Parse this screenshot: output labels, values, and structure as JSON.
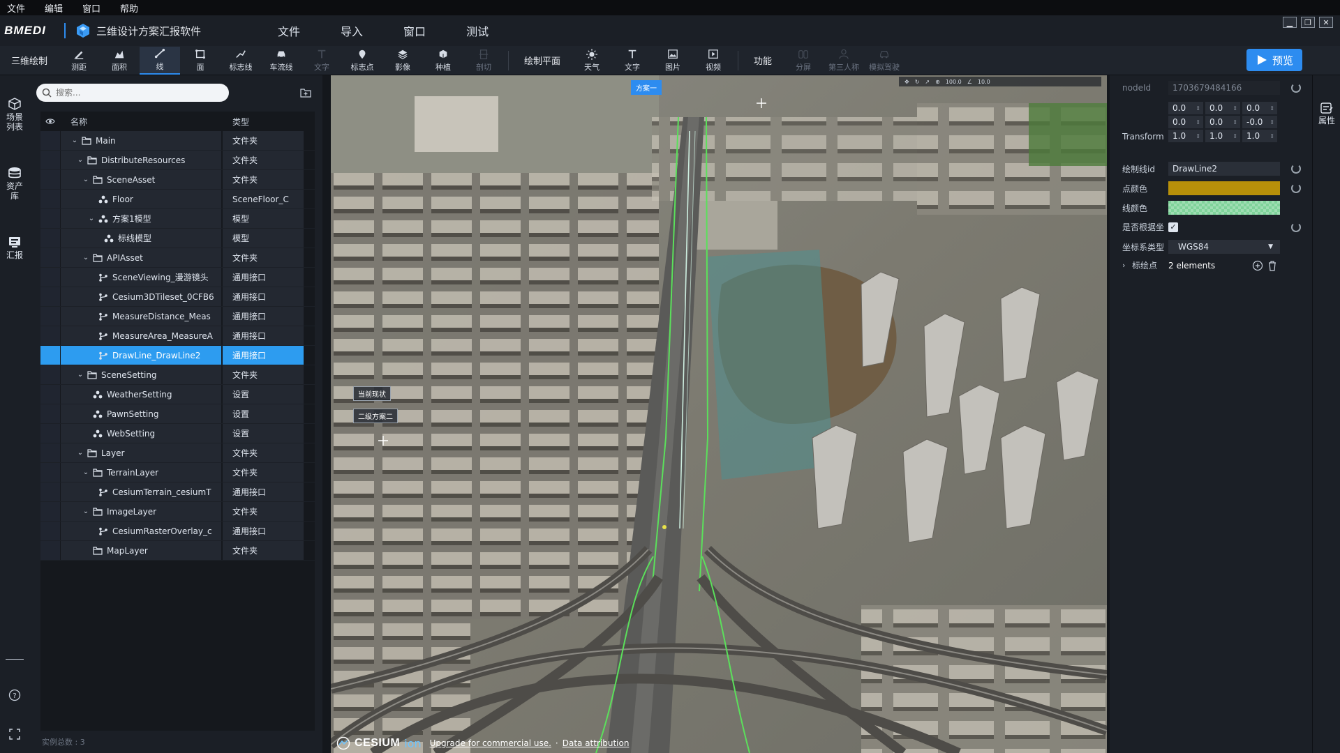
{
  "menubar": [
    "文件",
    "编辑",
    "窗口",
    "帮助"
  ],
  "titlebar": {
    "logo": "BMEDI",
    "app_title": "三维设计方案汇报软件",
    "menu": [
      "文件",
      "导入",
      "窗口",
      "测试"
    ]
  },
  "toolbar": {
    "section_draw": "三维绘制",
    "draw_tools": [
      {
        "label": "测距",
        "icon": "pen-icon",
        "active": false,
        "disabled": false
      },
      {
        "label": "面积",
        "icon": "area-icon",
        "active": false,
        "disabled": false
      },
      {
        "label": "线",
        "icon": "line-icon",
        "active": true,
        "disabled": false
      },
      {
        "label": "面",
        "icon": "polygon-icon",
        "active": false,
        "disabled": false
      },
      {
        "label": "标志线",
        "icon": "polyline-icon",
        "active": false,
        "disabled": false
      },
      {
        "label": "车流线",
        "icon": "car-icon",
        "active": false,
        "disabled": false
      },
      {
        "label": "文字",
        "icon": "text-icon",
        "active": false,
        "disabled": true
      },
      {
        "label": "标志点",
        "icon": "pin-icon",
        "active": false,
        "disabled": false
      },
      {
        "label": "影像",
        "icon": "image-layer-icon",
        "active": false,
        "disabled": false
      },
      {
        "label": "种植",
        "icon": "plant-icon",
        "active": false,
        "disabled": false
      },
      {
        "label": "剖切",
        "icon": "section-icon",
        "active": false,
        "disabled": true
      }
    ],
    "section_plane": "绘制平面",
    "plane_tools": [
      {
        "label": "天气",
        "icon": "sun-icon",
        "disabled": false
      },
      {
        "label": "文字",
        "icon": "text-icon",
        "disabled": false
      },
      {
        "label": "图片",
        "icon": "picture-icon",
        "disabled": false
      },
      {
        "label": "视频",
        "icon": "video-icon",
        "disabled": false
      }
    ],
    "section_func": "功能",
    "func_tools": [
      {
        "label": "分屏",
        "icon": "split-icon",
        "disabled": true
      },
      {
        "label": "第三人称",
        "icon": "person-icon",
        "disabled": true
      },
      {
        "label": "模拟驾驶",
        "icon": "drive-icon",
        "disabled": true
      }
    ],
    "preview_label": "预览"
  },
  "leftnav": [
    {
      "label": "场景列表",
      "icon": "cube-icon"
    },
    {
      "label": "资产库",
      "icon": "database-icon"
    },
    {
      "label": "汇报",
      "icon": "report-icon"
    }
  ],
  "scene": {
    "search_placeholder": "搜索...",
    "col_name": "名称",
    "col_type": "类型",
    "rows": [
      {
        "depth": 0,
        "caret": "v",
        "icon": "folder",
        "name": "Main",
        "type": "文件夹",
        "selected": false
      },
      {
        "depth": 1,
        "caret": "v",
        "icon": "folder",
        "name": "DistributeResources",
        "type": "文件夹",
        "selected": false
      },
      {
        "depth": 2,
        "caret": "v",
        "icon": "folder",
        "name": "SceneAsset",
        "type": "文件夹",
        "selected": false
      },
      {
        "depth": 3,
        "caret": "",
        "icon": "model",
        "name": "Floor",
        "type": "SceneFloor_C",
        "selected": false
      },
      {
        "depth": 3,
        "caret": "v",
        "icon": "model",
        "name": "方案1模型",
        "type": "模型",
        "selected": false
      },
      {
        "depth": 4,
        "caret": "",
        "icon": "model",
        "name": "标线模型",
        "type": "模型",
        "selected": false
      },
      {
        "depth": 2,
        "caret": "v",
        "icon": "folder",
        "name": "APIAsset",
        "type": "文件夹",
        "selected": false
      },
      {
        "depth": 3,
        "caret": "",
        "icon": "api",
        "name": "SceneViewing_漫游镜头",
        "type": "通用接口",
        "selected": false
      },
      {
        "depth": 3,
        "caret": "",
        "icon": "api",
        "name": "Cesium3DTileset_0CFB6",
        "type": "通用接口",
        "selected": false
      },
      {
        "depth": 3,
        "caret": "",
        "icon": "api",
        "name": "MeasureDistance_Meas",
        "type": "通用接口",
        "selected": false
      },
      {
        "depth": 3,
        "caret": "",
        "icon": "api",
        "name": "MeasureArea_MeasureA",
        "type": "通用接口",
        "selected": false
      },
      {
        "depth": 3,
        "caret": "",
        "icon": "api",
        "name": "DrawLine_DrawLine2",
        "type": "通用接口",
        "selected": true
      },
      {
        "depth": 1,
        "caret": "v",
        "icon": "folder",
        "name": "SceneSetting",
        "type": "文件夹",
        "selected": false
      },
      {
        "depth": 2,
        "caret": "",
        "icon": "model",
        "name": "WeatherSetting",
        "type": "设置",
        "selected": false
      },
      {
        "depth": 2,
        "caret": "",
        "icon": "model",
        "name": "PawnSetting",
        "type": "设置",
        "selected": false
      },
      {
        "depth": 2,
        "caret": "",
        "icon": "model",
        "name": "WebSetting",
        "type": "设置",
        "selected": false
      },
      {
        "depth": 1,
        "caret": "v",
        "icon": "folder",
        "name": "Layer",
        "type": "文件夹",
        "selected": false
      },
      {
        "depth": 2,
        "caret": "v",
        "icon": "folder",
        "name": "TerrainLayer",
        "type": "文件夹",
        "selected": false
      },
      {
        "depth": 3,
        "caret": "",
        "icon": "api",
        "name": "CesiumTerrain_cesiumT",
        "type": "通用接口",
        "selected": false
      },
      {
        "depth": 2,
        "caret": "v",
        "icon": "folder",
        "name": "ImageLayer",
        "type": "文件夹",
        "selected": false
      },
      {
        "depth": 3,
        "caret": "",
        "icon": "api",
        "name": "CesiumRasterOverlay_c",
        "type": "通用接口",
        "selected": false
      },
      {
        "depth": 2,
        "caret": "",
        "icon": "folder",
        "name": "MapLayer",
        "type": "文件夹",
        "selected": false
      }
    ],
    "instance_count": "实例总数 : 3"
  },
  "viewport": {
    "tag_plan1": "方案一",
    "tag_current": "当前现状",
    "tag_plan2": "二级方案二",
    "cesium_brand": "CESIUM",
    "cesium_ion": "ion",
    "upgrade_link": "Upgrade for commercial use.",
    "attribution_link": "Data attribution",
    "mini_value_1": "100.0",
    "mini_value_2": "10.0"
  },
  "props": {
    "nodeid_label": "nodeId",
    "nodeid_value": "1703679484166",
    "transform_label": "Transform",
    "transform": [
      [
        "0.0",
        "0.0",
        "0.0"
      ],
      [
        "0.0",
        "0.0",
        "-0.0"
      ],
      [
        "1.0",
        "1.0",
        "1.0"
      ]
    ],
    "drawline_id_label": "绘制线id",
    "drawline_id_value": "DrawLine2",
    "point_color_label": "点颜色",
    "point_color": "#b8900a",
    "line_color_label": "线颜色",
    "line_color": "#7fd39a",
    "snap_label": "是否根据坐",
    "snap_checked": true,
    "crs_label": "坐标系类型",
    "crs_value": "WGS84",
    "markers_label": "标绘点",
    "markers_value": "2 elements"
  },
  "rightstrip": {
    "label": "属性",
    "icon": "properties-icon"
  },
  "colors": {
    "accent": "#2d8cf0",
    "selected_row": "#2d9cf0"
  }
}
